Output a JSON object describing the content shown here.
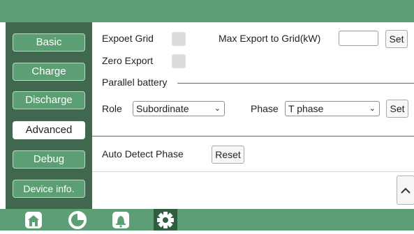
{
  "sidebar": {
    "items": [
      {
        "label": "Basic"
      },
      {
        "label": "Charge"
      },
      {
        "label": "Discharge"
      },
      {
        "label": "Advanced"
      },
      {
        "label": "Debug"
      },
      {
        "label": "Device info."
      }
    ],
    "active_index": 3
  },
  "settings": {
    "export_grid_label": "Expoet Grid",
    "max_export_label": "Max Export to Grid(kW)",
    "max_export_value": "",
    "set_label": "Set",
    "zero_export_label": "Zero Export",
    "parallel_battery_label": "Parallel battery",
    "role_label": "Role",
    "role_value": "Subordinate",
    "phase_label": "Phase",
    "phase_value": "T phase",
    "phase_set_label": "Set",
    "auto_detect_label": "Auto Detect Phase",
    "reset_label": "Reset"
  },
  "bottom_nav": {
    "icons": [
      "home-icon",
      "pie-chart-icon",
      "bell-icon",
      "gear-icon"
    ],
    "active_icon": "gear-icon"
  },
  "colors": {
    "accent": "#5c9f74",
    "sidebar": "#3f684f",
    "active_tab": "#ffffff"
  }
}
